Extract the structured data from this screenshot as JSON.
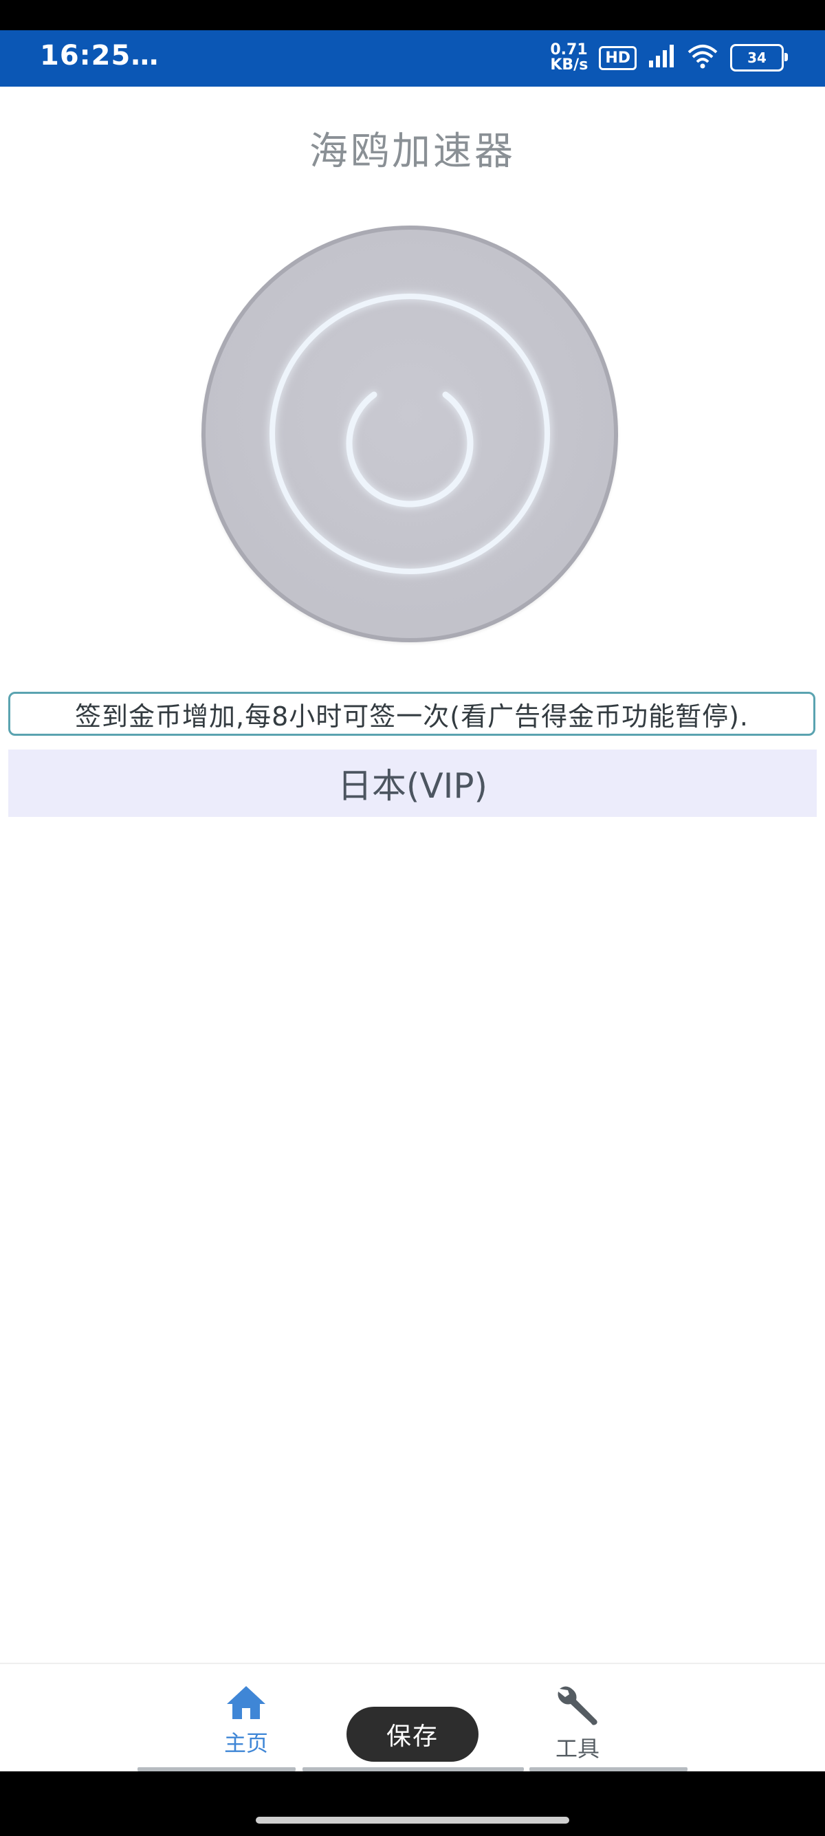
{
  "status_bar": {
    "time": "16:25",
    "overflow": "…",
    "net_speed_value": "0.71",
    "net_speed_unit": "KB/s",
    "hd_label": "HD",
    "battery": "34",
    "bg_color": "#0b57b5"
  },
  "app": {
    "title": "海鸥加速器"
  },
  "power_button": {
    "icon": "power-icon"
  },
  "notice": {
    "text": "签到金币增加,每8小时可签一次(看广告得金币功能暂停)."
  },
  "server": {
    "selected": "日本(VIP)"
  },
  "bottom_nav": {
    "home_label": "主页",
    "home_icon": "home-icon",
    "tools_label": "工具",
    "tools_icon": "wrench-icon",
    "save_label": "保存",
    "active_color": "#3f86d6"
  }
}
